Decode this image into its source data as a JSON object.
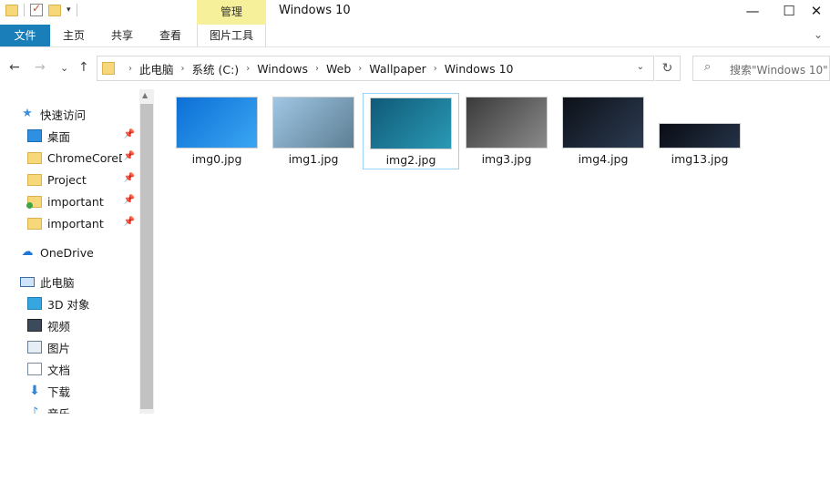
{
  "window": {
    "title": "Windows 10",
    "minimize_glyph": "—",
    "maximize_glyph": "☐",
    "close_glyph": "✕",
    "qat_dropdown_glyph": "▾"
  },
  "ribbon": {
    "contextual_group": "管理",
    "tabs": [
      {
        "label": "文件"
      },
      {
        "label": "主页"
      },
      {
        "label": "共享"
      },
      {
        "label": "查看"
      },
      {
        "label": "图片工具"
      }
    ],
    "expand_glyph": "⌄"
  },
  "nav": {
    "back_glyph": "←",
    "forward_glyph": "→",
    "recent_glyph": "⌄",
    "up_glyph": "↑",
    "breadcrumbs": [
      {
        "label": "此电脑"
      },
      {
        "label": "系统 (C:)"
      },
      {
        "label": "Windows"
      },
      {
        "label": "Web"
      },
      {
        "label": "Wallpaper"
      },
      {
        "label": "Windows 10"
      }
    ],
    "chevron_glyph": "›",
    "dropdown_glyph": "⌄",
    "refresh_glyph": "↻",
    "search_glyph": "⌕",
    "search_placeholder": "搜索\"Windows 10\""
  },
  "sidebar": {
    "quick_access": "快速访问",
    "pin_glyph": "📌",
    "star_glyph": "★",
    "pinned": [
      {
        "label": "桌面"
      },
      {
        "label": "ChromeCoreD"
      },
      {
        "label": "Project"
      },
      {
        "label": "important"
      },
      {
        "label": "important"
      }
    ],
    "onedrive": "OneDrive",
    "cloud_glyph": "☁",
    "this_pc": "此电脑",
    "pc_items": [
      {
        "label": "3D 对象"
      },
      {
        "label": "视频"
      },
      {
        "label": "图片"
      },
      {
        "label": "文档"
      },
      {
        "label": "下载"
      },
      {
        "label": "音乐"
      }
    ],
    "download_glyph": "⬇",
    "music_glyph": "♪",
    "scroll_up_glyph": "▲"
  },
  "files": [
    {
      "name": "img0.jpg",
      "selected": false,
      "thumb_colors": [
        "#0c6fd6",
        "#3aa6f2"
      ]
    },
    {
      "name": "img1.jpg",
      "selected": false,
      "thumb_colors": [
        "#9fc6e4",
        "#5e7f94"
      ]
    },
    {
      "name": "img2.jpg",
      "selected": true,
      "thumb_colors": [
        "#0f5a78",
        "#2a9ab5"
      ]
    },
    {
      "name": "img3.jpg",
      "selected": false,
      "thumb_colors": [
        "#3a3a3a",
        "#8a8a8a"
      ]
    },
    {
      "name": "img4.jpg",
      "selected": false,
      "thumb_colors": [
        "#0d1118",
        "#2c3b52"
      ]
    },
    {
      "name": "img13.jpg",
      "selected": false,
      "thumb_colors": [
        "#0a0d14",
        "#243247"
      ]
    }
  ],
  "colors": {
    "file_tab": "#1a7fb8",
    "manage_tab": "#f6f09a",
    "selection_border": "#99d1f7"
  }
}
